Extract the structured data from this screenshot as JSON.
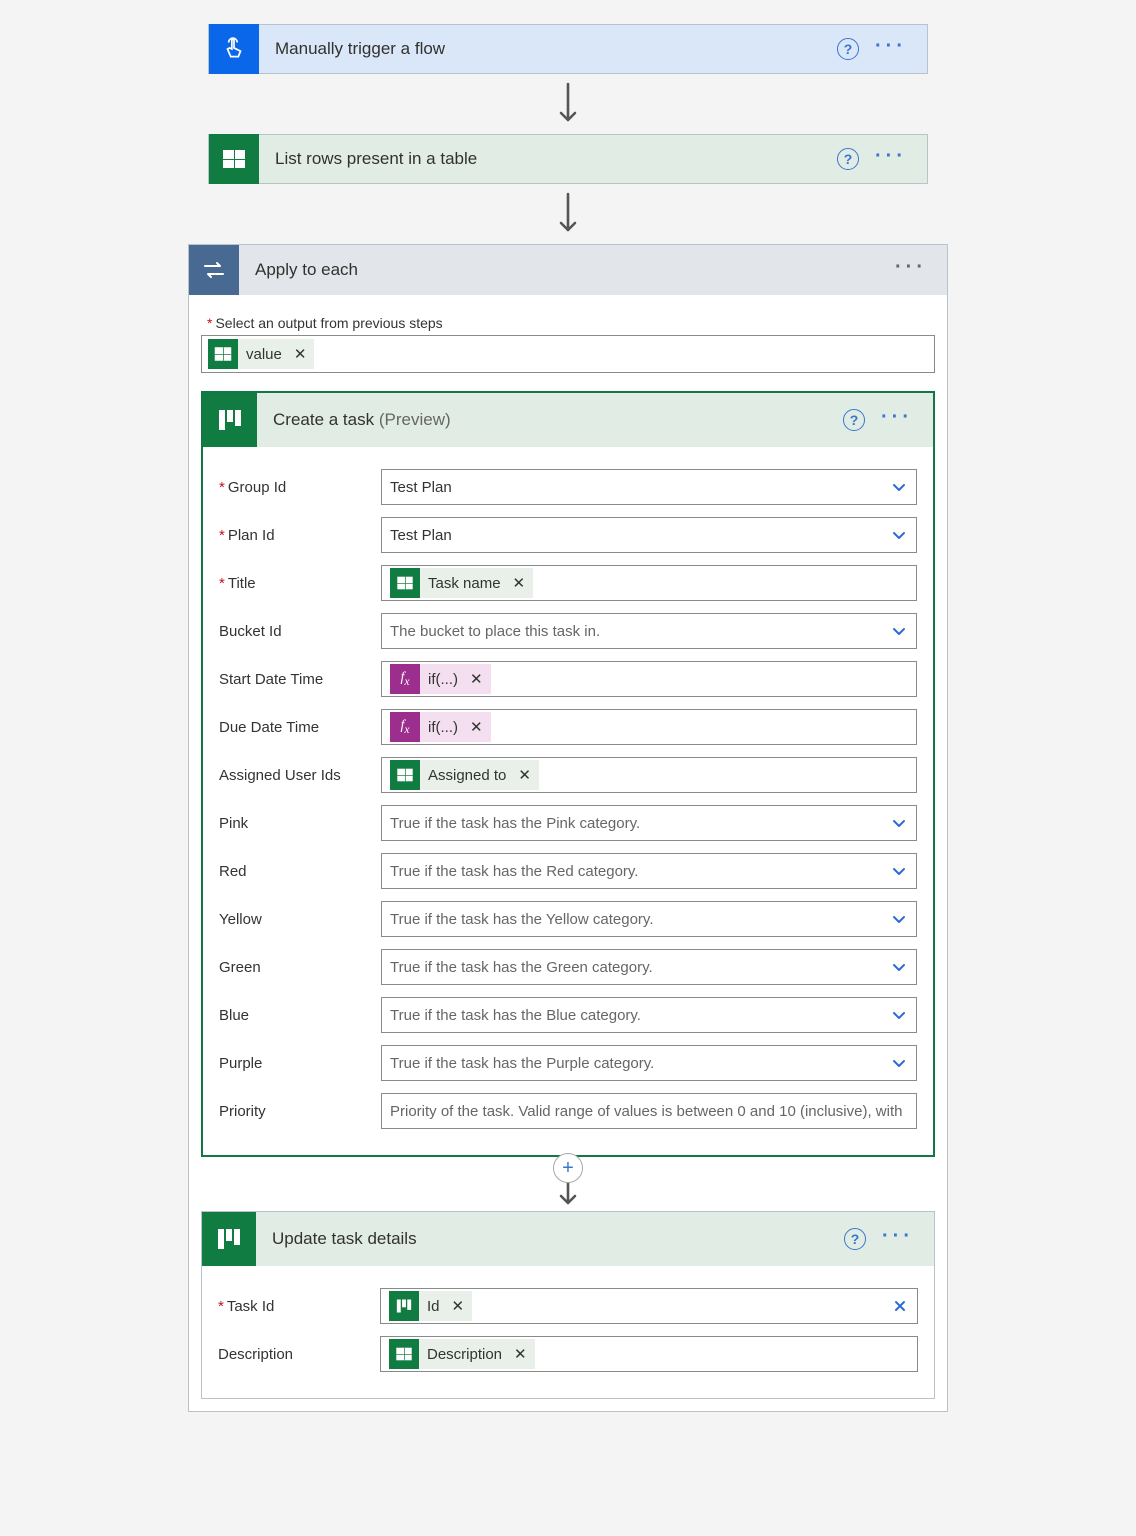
{
  "trigger": {
    "title": "Manually trigger a flow"
  },
  "listRows": {
    "title": "List rows present in a table"
  },
  "applyEach": {
    "title": "Apply to each",
    "selectLabel": "Select an output from previous steps",
    "token": "value"
  },
  "createTask": {
    "title": "Create a task",
    "suffix": "(Preview)",
    "fields": {
      "groupId": {
        "label": "Group Id",
        "value": "Test Plan",
        "required": true,
        "type": "select"
      },
      "planId": {
        "label": "Plan Id",
        "value": "Test Plan",
        "required": true,
        "type": "select"
      },
      "title": {
        "label": "Title",
        "token": "Task name",
        "tokenKind": "excel",
        "required": true
      },
      "bucketId": {
        "label": "Bucket Id",
        "placeholder": "The bucket to place this task in.",
        "type": "select"
      },
      "startDate": {
        "label": "Start Date Time",
        "token": "if(...)",
        "tokenKind": "fx"
      },
      "dueDate": {
        "label": "Due Date Time",
        "token": "if(...)",
        "tokenKind": "fx"
      },
      "assigned": {
        "label": "Assigned User Ids",
        "token": "Assigned to",
        "tokenKind": "excel"
      },
      "pink": {
        "label": "Pink",
        "placeholder": "True if the task has the Pink category.",
        "type": "select"
      },
      "red": {
        "label": "Red",
        "placeholder": "True if the task has the Red category.",
        "type": "select"
      },
      "yellow": {
        "label": "Yellow",
        "placeholder": "True if the task has the Yellow category.",
        "type": "select"
      },
      "green": {
        "label": "Green",
        "placeholder": "True if the task has the Green category.",
        "type": "select"
      },
      "blue": {
        "label": "Blue",
        "placeholder": "True if the task has the Blue category.",
        "type": "select"
      },
      "purple": {
        "label": "Purple",
        "placeholder": "True if the task has the Purple category.",
        "type": "select"
      },
      "priority": {
        "label": "Priority",
        "placeholder": "Priority of the task. Valid range of values is between 0 and 10 (inclusive), with"
      }
    }
  },
  "updateTask": {
    "title": "Update task details",
    "fields": {
      "taskId": {
        "label": "Task Id",
        "token": "Id",
        "tokenKind": "planner",
        "required": true,
        "clear": true
      },
      "description": {
        "label": "Description",
        "token": "Description",
        "tokenKind": "excel"
      }
    }
  }
}
